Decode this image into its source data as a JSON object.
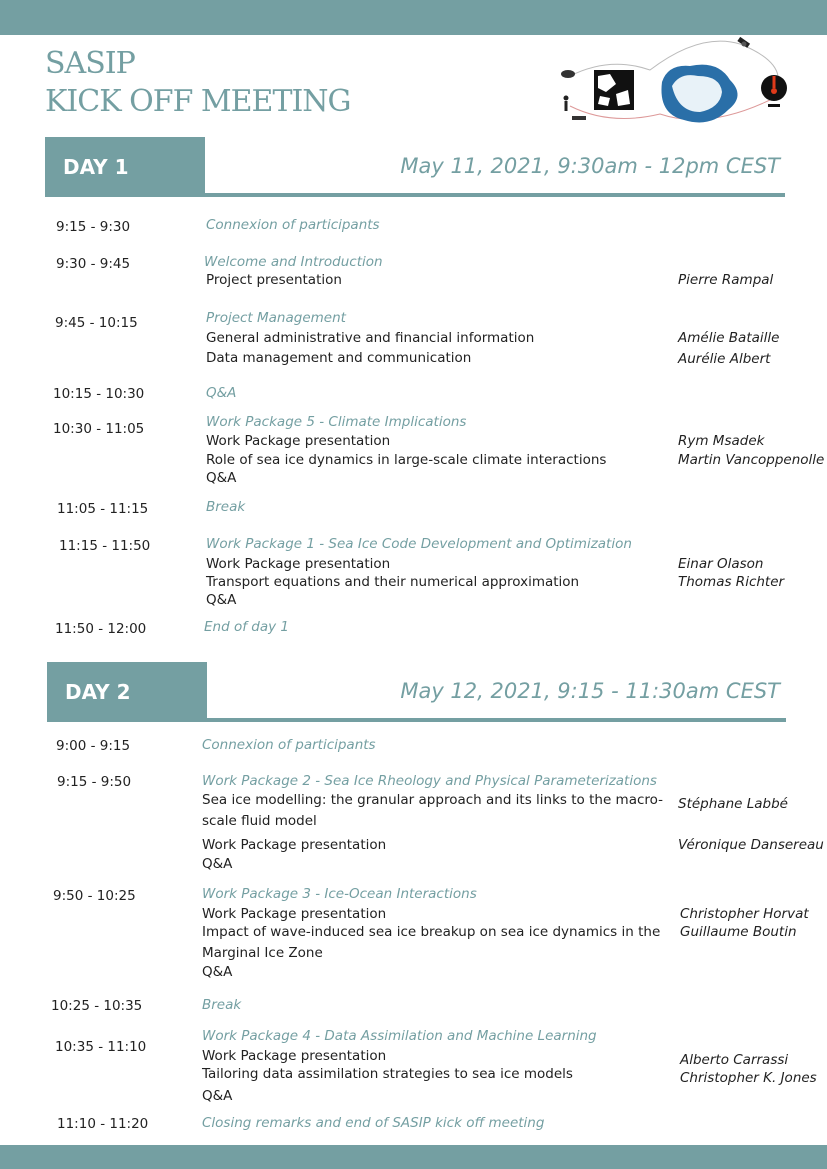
{
  "header": {
    "title_line1": "SASIP",
    "title_line2": "KICK OFF MEETING"
  },
  "day1": {
    "label": "DAY 1",
    "date": "May 11, 2021, 9:30am - 12pm CEST",
    "sessions": [
      {
        "time": "9:15 - 9:30",
        "title": "Connexion of participants"
      },
      {
        "time": "9:30 - 9:45",
        "title": "Welcome and Introduction",
        "items": [
          "Project presentation"
        ],
        "speakers": [
          "Pierre Rampal"
        ]
      },
      {
        "time": "9:45 - 10:15",
        "title": "Project Management",
        "items": [
          "General administrative and financial information",
          "Data management and communication"
        ],
        "speakers": [
          "Amélie Bataille",
          "Aurélie Albert"
        ]
      },
      {
        "time": "10:15 - 10:30",
        "title": "Q&A"
      },
      {
        "time": "10:30 - 11:05",
        "title": "Work Package 5 - Climate Implications",
        "items": [
          "Work Package presentation",
          "Role of sea ice dynamics in large-scale climate interactions",
          "Q&A"
        ],
        "speakers": [
          "Rym Msadek",
          "Martin Vancoppenolle"
        ]
      },
      {
        "time": "11:05 - 11:15",
        "title": "Break"
      },
      {
        "time": "11:15 - 11:50",
        "title": "Work Package 1 - Sea Ice Code Development and Optimization",
        "items": [
          "Work Package presentation",
          "Transport equations and their numerical approximation",
          "Q&A"
        ],
        "speakers": [
          "Einar Olason",
          "Thomas Richter"
        ]
      },
      {
        "time": "11:50 - 12:00",
        "title": "End of day 1"
      }
    ]
  },
  "day2": {
    "label": "DAY 2",
    "date": "May 12, 2021, 9:15 - 11:30am CEST",
    "sessions": [
      {
        "time": "9:00 - 9:15",
        "title": "Connexion of participants"
      },
      {
        "time": "9:15 - 9:50",
        "title": "Work Package 2 - Sea Ice Rheology and Physical Parameterizations",
        "items": [
          "Sea ice modelling: the granular approach and its links to the macro-",
          "scale fluid model",
          "Work Package presentation",
          "Q&A"
        ],
        "speakers": [
          "Stéphane Labbé",
          "Véronique Dansereau"
        ]
      },
      {
        "time": "9:50 - 10:25",
        "title": "Work Package 3 - Ice-Ocean Interactions",
        "items": [
          "Work Package presentation",
          "Impact of wave-induced sea ice breakup on sea ice dynamics in the",
          "Marginal Ice Zone",
          "Q&A"
        ],
        "speakers": [
          "Christopher Horvat",
          "Guillaume Boutin"
        ]
      },
      {
        "time": "10:25 - 10:35",
        "title": "Break"
      },
      {
        "time": "10:35 - 11:10",
        "title": "Work Package 4 -  Data Assimilation and Machine Learning",
        "items": [
          "Work Package presentation",
          "Tailoring data assimilation strategies to sea ice models",
          "Q&A"
        ],
        "speakers": [
          "Alberto Carrassi",
          "Christopher K. Jones"
        ]
      },
      {
        "time": "11:10 - 11:20",
        "title": "Closing remarks and end of SASIP kick off meeting"
      }
    ]
  },
  "colors": {
    "accent": "#749fa2",
    "text": "#222222"
  },
  "icons": [
    "polar-bear-icon",
    "person-icon",
    "ship-icon",
    "ice-floe-image",
    "sea-ice-map-image",
    "satellite-icon",
    "globe-thermometer-icon"
  ]
}
